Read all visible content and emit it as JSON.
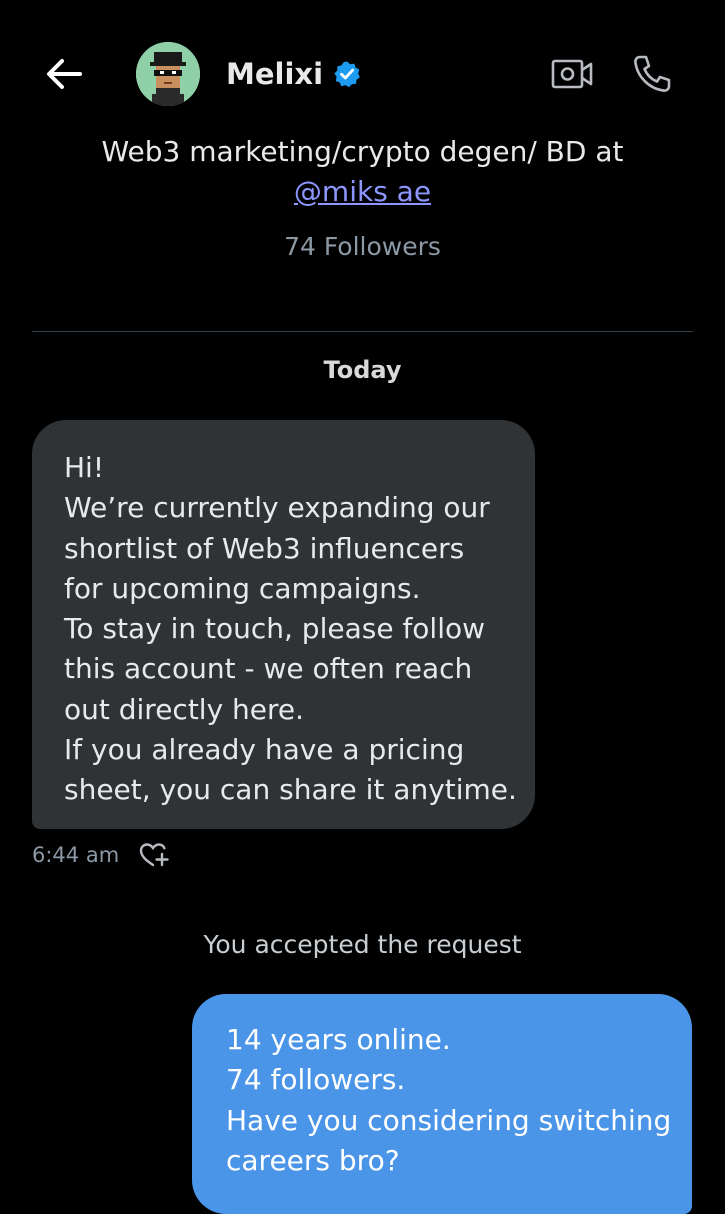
{
  "header": {
    "name": "Melixi",
    "verified_color": "#1d9bf0",
    "back_icon": "arrow-left-icon",
    "video_icon": "video-camera-icon",
    "call_icon": "phone-icon"
  },
  "profile": {
    "bio_text": "Web3 marketing/crypto degen/ BD at",
    "bio_link": "@miks ae",
    "followers": "74 Followers"
  },
  "conversation": {
    "date_separator": "Today",
    "incoming_message": {
      "lines": [
        "Hi!",
        "We’re currently expanding our",
        "shortlist of Web3 influencers",
        "for upcoming campaigns.",
        "To stay in touch, please follow",
        "this account - we often reach",
        "out directly here.",
        "If you already have a pricing",
        "sheet, you can share it anytime."
      ],
      "time": "6:44 am",
      "react_icon": "heart-plus-icon"
    },
    "system_note": "You accepted the request",
    "outgoing_message": {
      "lines": [
        "14 years online.",
        "74 followers.",
        "Have you considering switching",
        "careers bro?"
      ]
    }
  },
  "colors": {
    "background": "#000000",
    "incoming_bubble": "#2f3336",
    "outgoing_bubble": "#4a95e8",
    "link": "#8d96ff",
    "secondary_text": "#8b98a5"
  }
}
